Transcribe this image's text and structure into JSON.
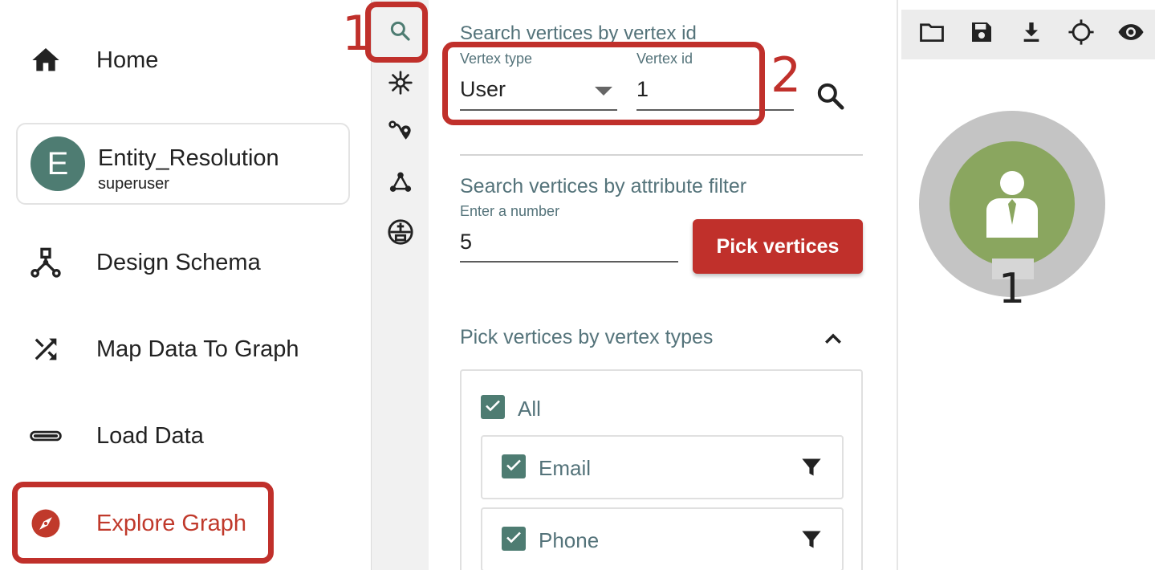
{
  "nav": {
    "home": "Home",
    "graph": {
      "avatar_letter": "E",
      "name": "Entity_Resolution",
      "user": "superuser"
    },
    "design_schema": "Design Schema",
    "map_data": "Map Data To Graph",
    "load_data": "Load Data",
    "explore_graph": "Explore Graph"
  },
  "callouts": [
    "1",
    "2"
  ],
  "rail_icons": [
    "search-icon",
    "expand-icon",
    "path-icon",
    "graph-algorithm-icon",
    "query-icon"
  ],
  "search_by_id": {
    "title": "Search vertices by vertex id",
    "vertex_type_label": "Vertex type",
    "vertex_type_value": "User",
    "vertex_id_label": "Vertex id",
    "vertex_id_value": "1"
  },
  "attribute_filter": {
    "title": "Search vertices by attribute filter",
    "number_label": "Enter a number",
    "number_value": "5",
    "pick_button": "Pick vertices"
  },
  "vertex_types": {
    "title": "Pick vertices by vertex types",
    "all_label": "All",
    "items": [
      {
        "label": "Email",
        "checked": true
      },
      {
        "label": "Phone",
        "checked": true
      }
    ]
  },
  "canvas": {
    "toolbar_icons": [
      "folder-icon",
      "save-icon",
      "download-icon",
      "locate-icon",
      "eye-icon"
    ],
    "vertex_label": "1"
  },
  "colors": {
    "accent_red": "#c0302b",
    "teal": "#4e7c72",
    "label_teal": "#54737a",
    "vertex_green": "#8aa65f",
    "vertex_ring": "#c4c4c4"
  }
}
